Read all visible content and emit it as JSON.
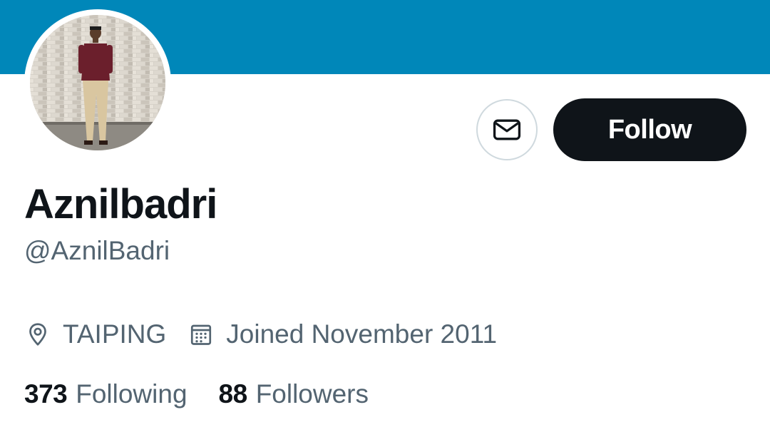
{
  "profile": {
    "display_name": "Aznilbadri",
    "handle": "@AznilBadri",
    "location": "TAIPING",
    "joined": "Joined November 2011",
    "banner_color": "#0087b9"
  },
  "actions": {
    "message_icon": "envelope-icon",
    "follow_label": "Follow"
  },
  "stats": {
    "following_count": "373",
    "following_label": "Following",
    "followers_count": "88",
    "followers_label": "Followers"
  },
  "icons": {
    "location": "location-pin-icon",
    "joined": "calendar-icon"
  }
}
